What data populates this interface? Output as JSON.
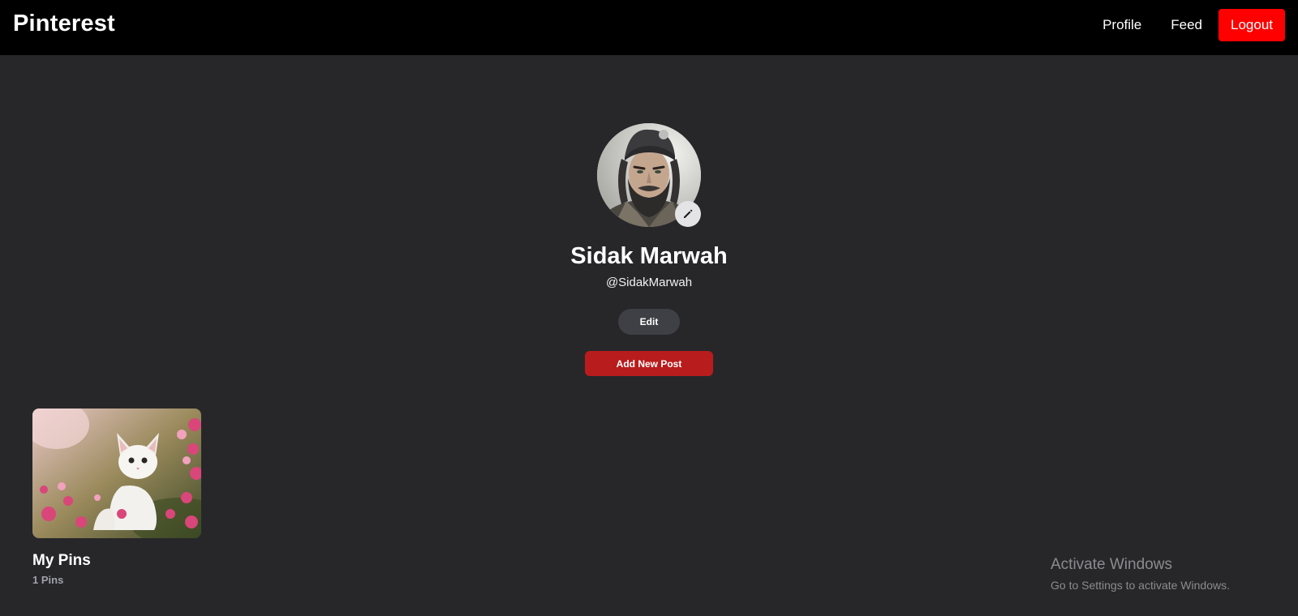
{
  "navbar": {
    "brand": "Pinterest",
    "links": {
      "profile": "Profile",
      "feed": "Feed",
      "logout": "Logout"
    }
  },
  "profile": {
    "avatar_icon": "user-portrait",
    "edit_photo_icon": "pencil-icon",
    "name": "Sidak Marwah",
    "username": "@SidakMarwah",
    "edit_label": "Edit",
    "add_post_label": "Add New Post"
  },
  "boards": [
    {
      "title": "My Pins",
      "count_label": "1 Pins",
      "thumbnail": "white-kitten-in-pink-flowers"
    }
  ],
  "watermark": {
    "title": "Activate Windows",
    "subtitle": "Go to Settings to activate Windows."
  },
  "colors": {
    "background": "#27272a",
    "navbar": "#000000",
    "logout": "#ff0000",
    "add_post": "#b91c1c",
    "edit_button": "#3f3f46"
  }
}
